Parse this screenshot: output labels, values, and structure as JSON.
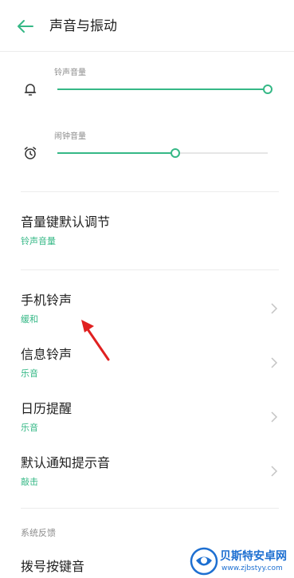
{
  "header": {
    "title": "声音与振动"
  },
  "volume": {
    "ringtone_label": "铃声音量",
    "ringtone_level": 1.0,
    "alarm_label": "闹钟音量",
    "alarm_level": 0.56
  },
  "volume_keys": {
    "title": "音量键默认调节",
    "value": "铃声音量"
  },
  "items": [
    {
      "title": "手机铃声",
      "value": "缓和"
    },
    {
      "title": "信息铃声",
      "value": "乐音"
    },
    {
      "title": "日历提醒",
      "value": "乐音"
    },
    {
      "title": "默认通知提示音",
      "value": "敲击"
    }
  ],
  "system_feedback": {
    "header": "系统反馈",
    "dial_keypad": "拨号按键音"
  },
  "watermark": {
    "name": "贝斯特安卓网",
    "url": "www.zjbstyy.com"
  },
  "colors": {
    "accent": "#35b886",
    "annotation_arrow": "#e02020",
    "watermark": "#1d6fd1"
  },
  "icons": {
    "back": "arrow-left-icon",
    "ringtone": "bell-icon",
    "alarm": "alarm-clock-icon",
    "chevron": "chevron-right-icon"
  }
}
